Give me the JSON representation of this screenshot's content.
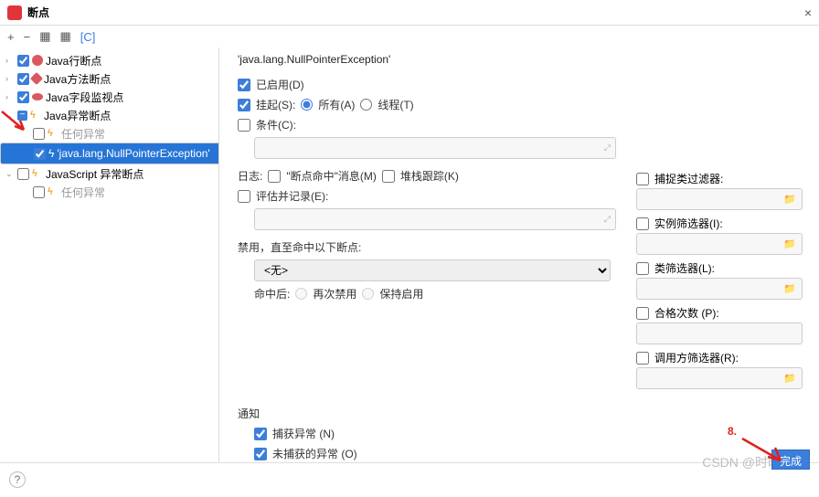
{
  "window": {
    "title": "断点"
  },
  "toolbar": {
    "add": "+",
    "remove": "−",
    "group1": "⧉",
    "group2": "⧉",
    "group3": "[C]"
  },
  "tree": {
    "n0": {
      "label": "Java行断点"
    },
    "n1": {
      "label": "Java方法断点"
    },
    "n2": {
      "label": "Java字段监视点"
    },
    "n3": {
      "label": "Java异常断点"
    },
    "n3a": {
      "label": "任何异常"
    },
    "n3b": {
      "label": "'java.lang.NullPointerException'"
    },
    "n4": {
      "label": "JavaScript 异常断点"
    },
    "n4a": {
      "label": "任何异常"
    }
  },
  "details": {
    "header": "'java.lang.NullPointerException'",
    "enabled": "已启用(D)",
    "suspend": "挂起(S):",
    "suspend_all": "所有(A)",
    "suspend_thread": "线程(T)",
    "condition": "条件(C):",
    "log_label": "日志:",
    "log_hit": "\"断点命中\"消息(M)",
    "log_stack": "堆栈跟踪(K)",
    "eval": "评估并记录(E):",
    "disable_until": "禁用，直至命中以下断点:",
    "none": "<无>",
    "after_hit": "命中后:",
    "redisable": "再次禁用",
    "keep": "保持启用",
    "notify": "通知",
    "caught": "捕获异常 (N)",
    "uncaught": "未捕获的异常 (O)"
  },
  "filters": {
    "catch": "捕捉类过滤器:",
    "instance": "实例筛选器(I):",
    "class": "类筛选器(L):",
    "pass": "合格次数 (P):",
    "caller": "调用方筛选器(R):"
  },
  "footer": {
    "watermark": "CSDN @时时师师",
    "done": "完成"
  },
  "annot": {
    "num": "8."
  }
}
